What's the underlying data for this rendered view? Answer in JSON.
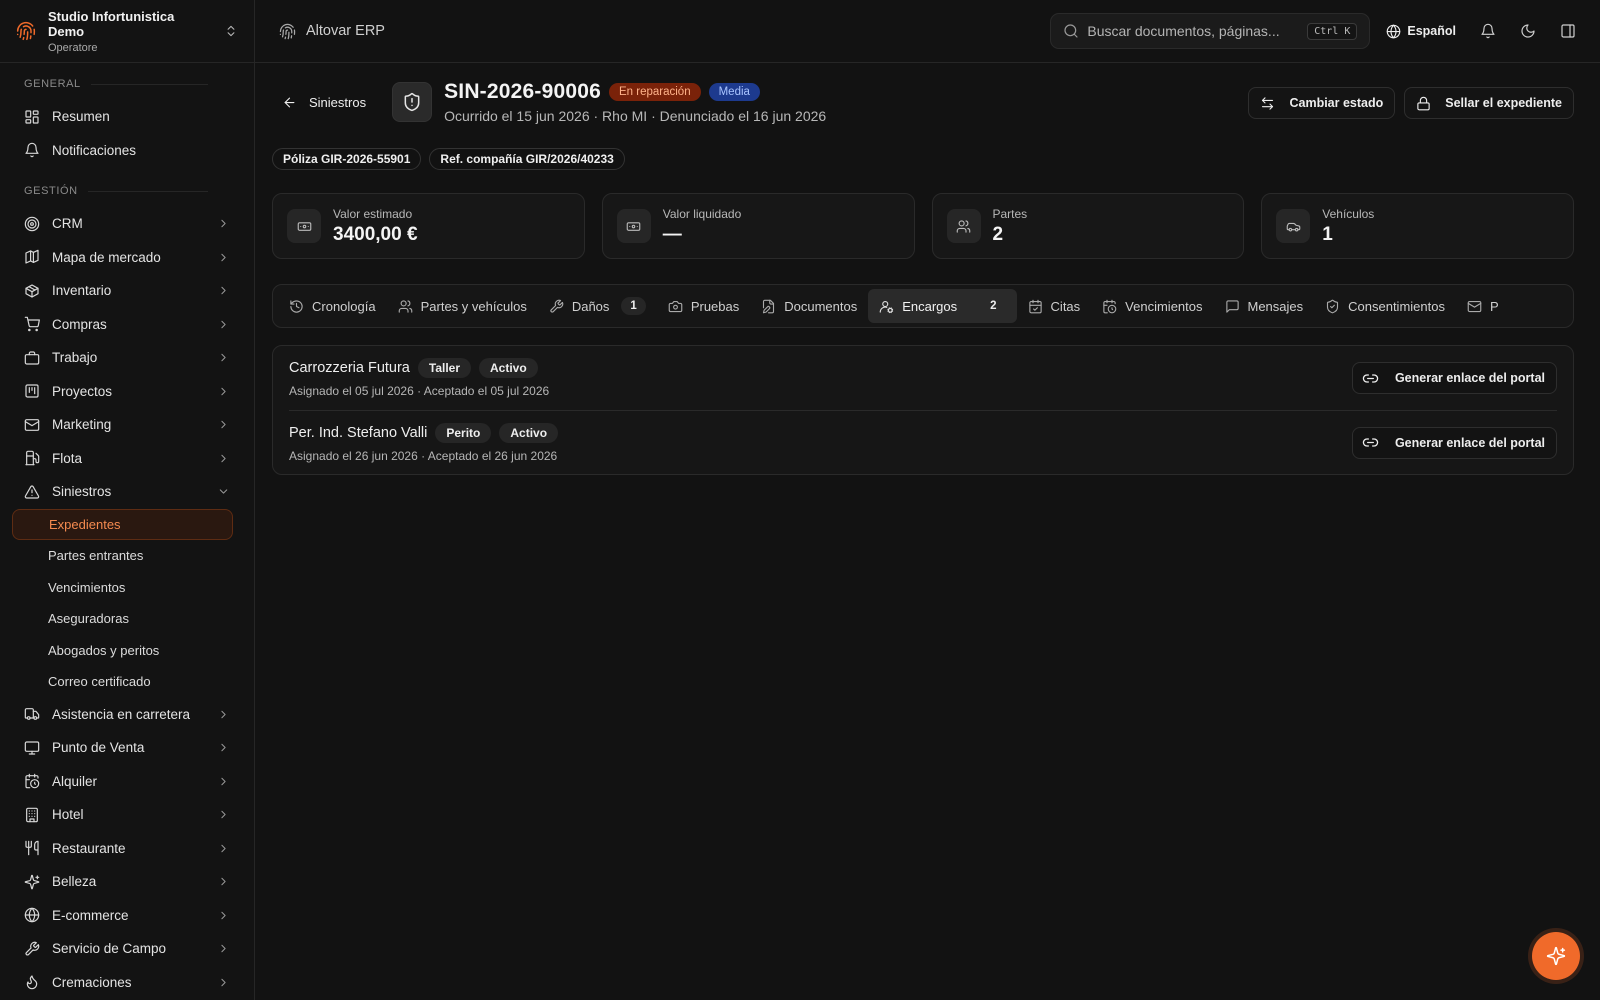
{
  "sidebar": {
    "org_name": "Studio Infortunistica Demo",
    "org_role": "Operatore",
    "sections": {
      "general": "GENERAL",
      "management": "GESTIÓN"
    },
    "general_items": [
      {
        "label": "Resumen"
      },
      {
        "label": "Notificaciones"
      }
    ],
    "management_items": [
      {
        "label": "CRM"
      },
      {
        "label": "Mapa de mercado"
      },
      {
        "label": "Inventario"
      },
      {
        "label": "Compras"
      },
      {
        "label": "Trabajo"
      },
      {
        "label": "Proyectos"
      },
      {
        "label": "Marketing"
      },
      {
        "label": "Flota"
      },
      {
        "label": "Siniestros"
      }
    ],
    "claims_subitems": [
      {
        "label": "Expedientes"
      },
      {
        "label": "Partes entrantes"
      },
      {
        "label": "Vencimientos"
      },
      {
        "label": "Aseguradoras"
      },
      {
        "label": "Abogados y peritos"
      },
      {
        "label": "Correo certificado"
      }
    ],
    "more_items": [
      {
        "label": "Asistencia en carretera"
      },
      {
        "label": "Punto de Venta"
      },
      {
        "label": "Alquiler"
      },
      {
        "label": "Hotel"
      },
      {
        "label": "Restaurante"
      },
      {
        "label": "Belleza"
      },
      {
        "label": "E-commerce"
      },
      {
        "label": "Servicio de Campo"
      },
      {
        "label": "Cremaciones"
      }
    ]
  },
  "topbar": {
    "app_name": "Altovar ERP",
    "search_placeholder": "Buscar documentos, páginas...",
    "search_shortcut": "Ctrl K",
    "language": "Español"
  },
  "header": {
    "back_label": "Siniestros",
    "title": "SIN-2026-90006",
    "status_badge": "En reparación",
    "priority_badge": "Media",
    "subtitle": "Ocurrido el 15 jun 2026 · Rho MI · Denunciado el 16 jun 2026",
    "change_status_label": "Cambiar estado",
    "seal_label": "Sellar el expediente"
  },
  "chips": {
    "policy": "Póliza GIR-2026-55901",
    "company_ref": "Ref. compañía GIR/2026/40233"
  },
  "stats": [
    {
      "label": "Valor estimado",
      "value": "3400,00 €"
    },
    {
      "label": "Valor liquidado",
      "value": "—"
    },
    {
      "label": "Partes",
      "value": "2"
    },
    {
      "label": "Vehículos",
      "value": "1"
    }
  ],
  "tabs": [
    {
      "label": "Cronología"
    },
    {
      "label": "Partes y vehículos"
    },
    {
      "label": "Daños",
      "count": "1"
    },
    {
      "label": "Pruebas"
    },
    {
      "label": "Documentos"
    },
    {
      "label": "Encargos",
      "count": "2"
    },
    {
      "label": "Citas"
    },
    {
      "label": "Vencimientos"
    },
    {
      "label": "Mensajes"
    },
    {
      "label": "Consentimientos"
    },
    {
      "label": "P"
    }
  ],
  "assignments": [
    {
      "name": "Carrozzeria Futura",
      "type": "Taller",
      "state": "Activo",
      "meta": "Asignado el 05 jul 2026 · Aceptado el 05 jul 2026",
      "action": "Generar enlace del portal"
    },
    {
      "name": "Per. Ind. Stefano Valli",
      "type": "Perito",
      "state": "Activo",
      "meta": "Asignado el 26 jun 2026 · Aceptado el 26 jun 2026",
      "action": "Generar enlace del portal"
    }
  ],
  "colors": {
    "accent": "#f06a2a",
    "status_repair_bg": "#7a2209",
    "priority_bg": "#1d3a8e"
  }
}
